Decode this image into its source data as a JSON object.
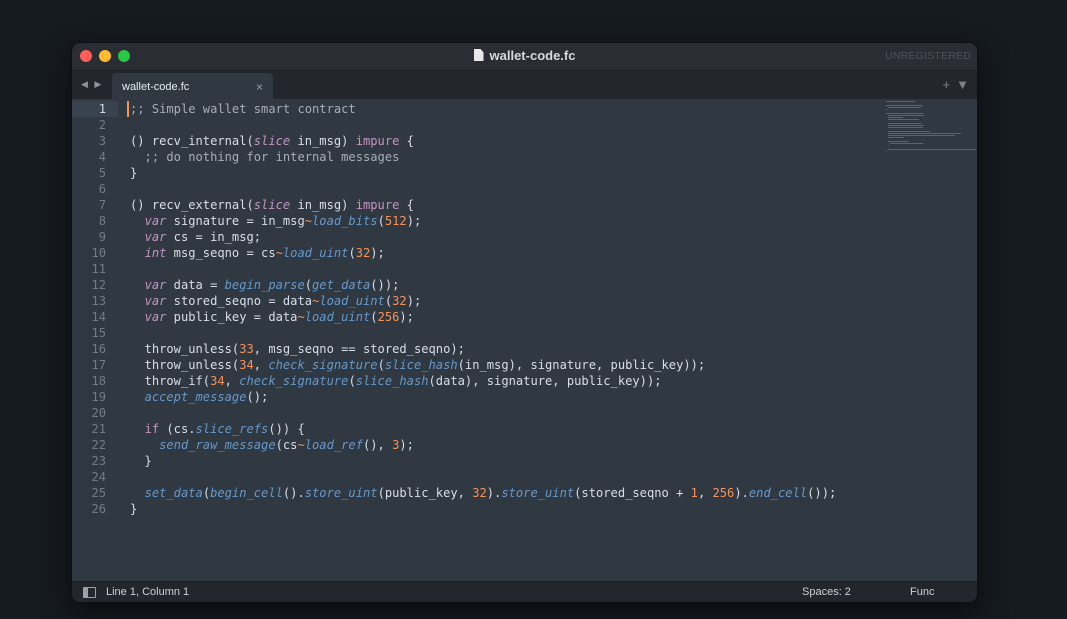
{
  "window": {
    "title": "wallet-code.fc",
    "unregistered": "UNREGISTERED"
  },
  "tabs": [
    {
      "label": "wallet-code.fc",
      "close": "×"
    }
  ],
  "tabbar": {
    "nav_arrows": "◀ ▶",
    "add": "+",
    "menu": "▼"
  },
  "editor": {
    "current_line": 1,
    "lines": [
      [
        {
          "t": ";; Simple wallet smart contract",
          "c": "cm"
        }
      ],
      [],
      [
        {
          "t": "() recv_internal("
        },
        {
          "t": "slice",
          "c": "ty"
        },
        {
          "t": " in_msg) "
        },
        {
          "t": "impure",
          "c": "k"
        },
        {
          "t": " {"
        }
      ],
      [
        {
          "t": "  ;; do nothing for internal messages",
          "c": "cm"
        }
      ],
      [
        {
          "t": "}"
        }
      ],
      [],
      [
        {
          "t": "() recv_external("
        },
        {
          "t": "slice",
          "c": "ty"
        },
        {
          "t": " in_msg) "
        },
        {
          "t": "impure",
          "c": "k"
        },
        {
          "t": " {"
        }
      ],
      [
        {
          "t": "  "
        },
        {
          "t": "var",
          "c": "ty"
        },
        {
          "t": " signature = in_msg"
        },
        {
          "t": "~",
          "c": "n"
        },
        {
          "t": "load_bits",
          "c": "fn"
        },
        {
          "t": "("
        },
        {
          "t": "512",
          "c": "n"
        },
        {
          "t": ");"
        }
      ],
      [
        {
          "t": "  "
        },
        {
          "t": "var",
          "c": "ty"
        },
        {
          "t": " cs = in_msg;"
        }
      ],
      [
        {
          "t": "  "
        },
        {
          "t": "int",
          "c": "ty"
        },
        {
          "t": " msg_seqno = cs"
        },
        {
          "t": "~",
          "c": "n"
        },
        {
          "t": "load_uint",
          "c": "fn"
        },
        {
          "t": "("
        },
        {
          "t": "32",
          "c": "n"
        },
        {
          "t": ");"
        }
      ],
      [],
      [
        {
          "t": "  "
        },
        {
          "t": "var",
          "c": "ty"
        },
        {
          "t": " data = "
        },
        {
          "t": "begin_parse",
          "c": "fn"
        },
        {
          "t": "("
        },
        {
          "t": "get_data",
          "c": "fn"
        },
        {
          "t": "());"
        }
      ],
      [
        {
          "t": "  "
        },
        {
          "t": "var",
          "c": "ty"
        },
        {
          "t": " stored_seqno = data"
        },
        {
          "t": "~",
          "c": "n"
        },
        {
          "t": "load_uint",
          "c": "fn"
        },
        {
          "t": "("
        },
        {
          "t": "32",
          "c": "n"
        },
        {
          "t": ");"
        }
      ],
      [
        {
          "t": "  "
        },
        {
          "t": "var",
          "c": "ty"
        },
        {
          "t": " public_key = data"
        },
        {
          "t": "~",
          "c": "n"
        },
        {
          "t": "load_uint",
          "c": "fn"
        },
        {
          "t": "("
        },
        {
          "t": "256",
          "c": "n"
        },
        {
          "t": ");"
        }
      ],
      [],
      [
        {
          "t": "  throw_unless("
        },
        {
          "t": "33",
          "c": "n"
        },
        {
          "t": ", msg_seqno == stored_seqno);"
        }
      ],
      [
        {
          "t": "  throw_unless("
        },
        {
          "t": "34",
          "c": "n"
        },
        {
          "t": ", "
        },
        {
          "t": "check_signature",
          "c": "fn"
        },
        {
          "t": "("
        },
        {
          "t": "slice_hash",
          "c": "fn"
        },
        {
          "t": "(in_msg), signature, public_key));"
        }
      ],
      [
        {
          "t": "  throw_if("
        },
        {
          "t": "34",
          "c": "n"
        },
        {
          "t": ", "
        },
        {
          "t": "check_signature",
          "c": "fn"
        },
        {
          "t": "("
        },
        {
          "t": "slice_hash",
          "c": "fn"
        },
        {
          "t": "(data), signature, public_key));"
        }
      ],
      [
        {
          "t": "  "
        },
        {
          "t": "accept_message",
          "c": "fn"
        },
        {
          "t": "();"
        }
      ],
      [],
      [
        {
          "t": "  "
        },
        {
          "t": "if",
          "c": "k"
        },
        {
          "t": " (cs."
        },
        {
          "t": "slice_refs",
          "c": "fn"
        },
        {
          "t": "()) {"
        }
      ],
      [
        {
          "t": "    "
        },
        {
          "t": "send_raw_message",
          "c": "fn"
        },
        {
          "t": "(cs"
        },
        {
          "t": "~",
          "c": "n"
        },
        {
          "t": "load_ref",
          "c": "fn"
        },
        {
          "t": "(), "
        },
        {
          "t": "3",
          "c": "n"
        },
        {
          "t": ");"
        }
      ],
      [
        {
          "t": "  }"
        }
      ],
      [],
      [
        {
          "t": "  "
        },
        {
          "t": "set_data",
          "c": "fn"
        },
        {
          "t": "("
        },
        {
          "t": "begin_cell",
          "c": "fn"
        },
        {
          "t": "()."
        },
        {
          "t": "store_uint",
          "c": "fn"
        },
        {
          "t": "(public_key, "
        },
        {
          "t": "32",
          "c": "n"
        },
        {
          "t": ")."
        },
        {
          "t": "store_uint",
          "c": "fn"
        },
        {
          "t": "(stored_seqno + "
        },
        {
          "t": "1",
          "c": "n"
        },
        {
          "t": ", "
        },
        {
          "t": "256",
          "c": "n"
        },
        {
          "t": ")."
        },
        {
          "t": "end_cell",
          "c": "fn"
        },
        {
          "t": "());"
        }
      ],
      [
        {
          "t": "}"
        }
      ]
    ]
  },
  "statusbar": {
    "position": "Line 1, Column 1",
    "indent": "Spaces: 2",
    "syntax": "Func"
  },
  "colors": {
    "background": "#303841",
    "keyword": "#c594c5",
    "function": "#6699cc",
    "number": "#f99157",
    "comment": "#a7adba"
  }
}
